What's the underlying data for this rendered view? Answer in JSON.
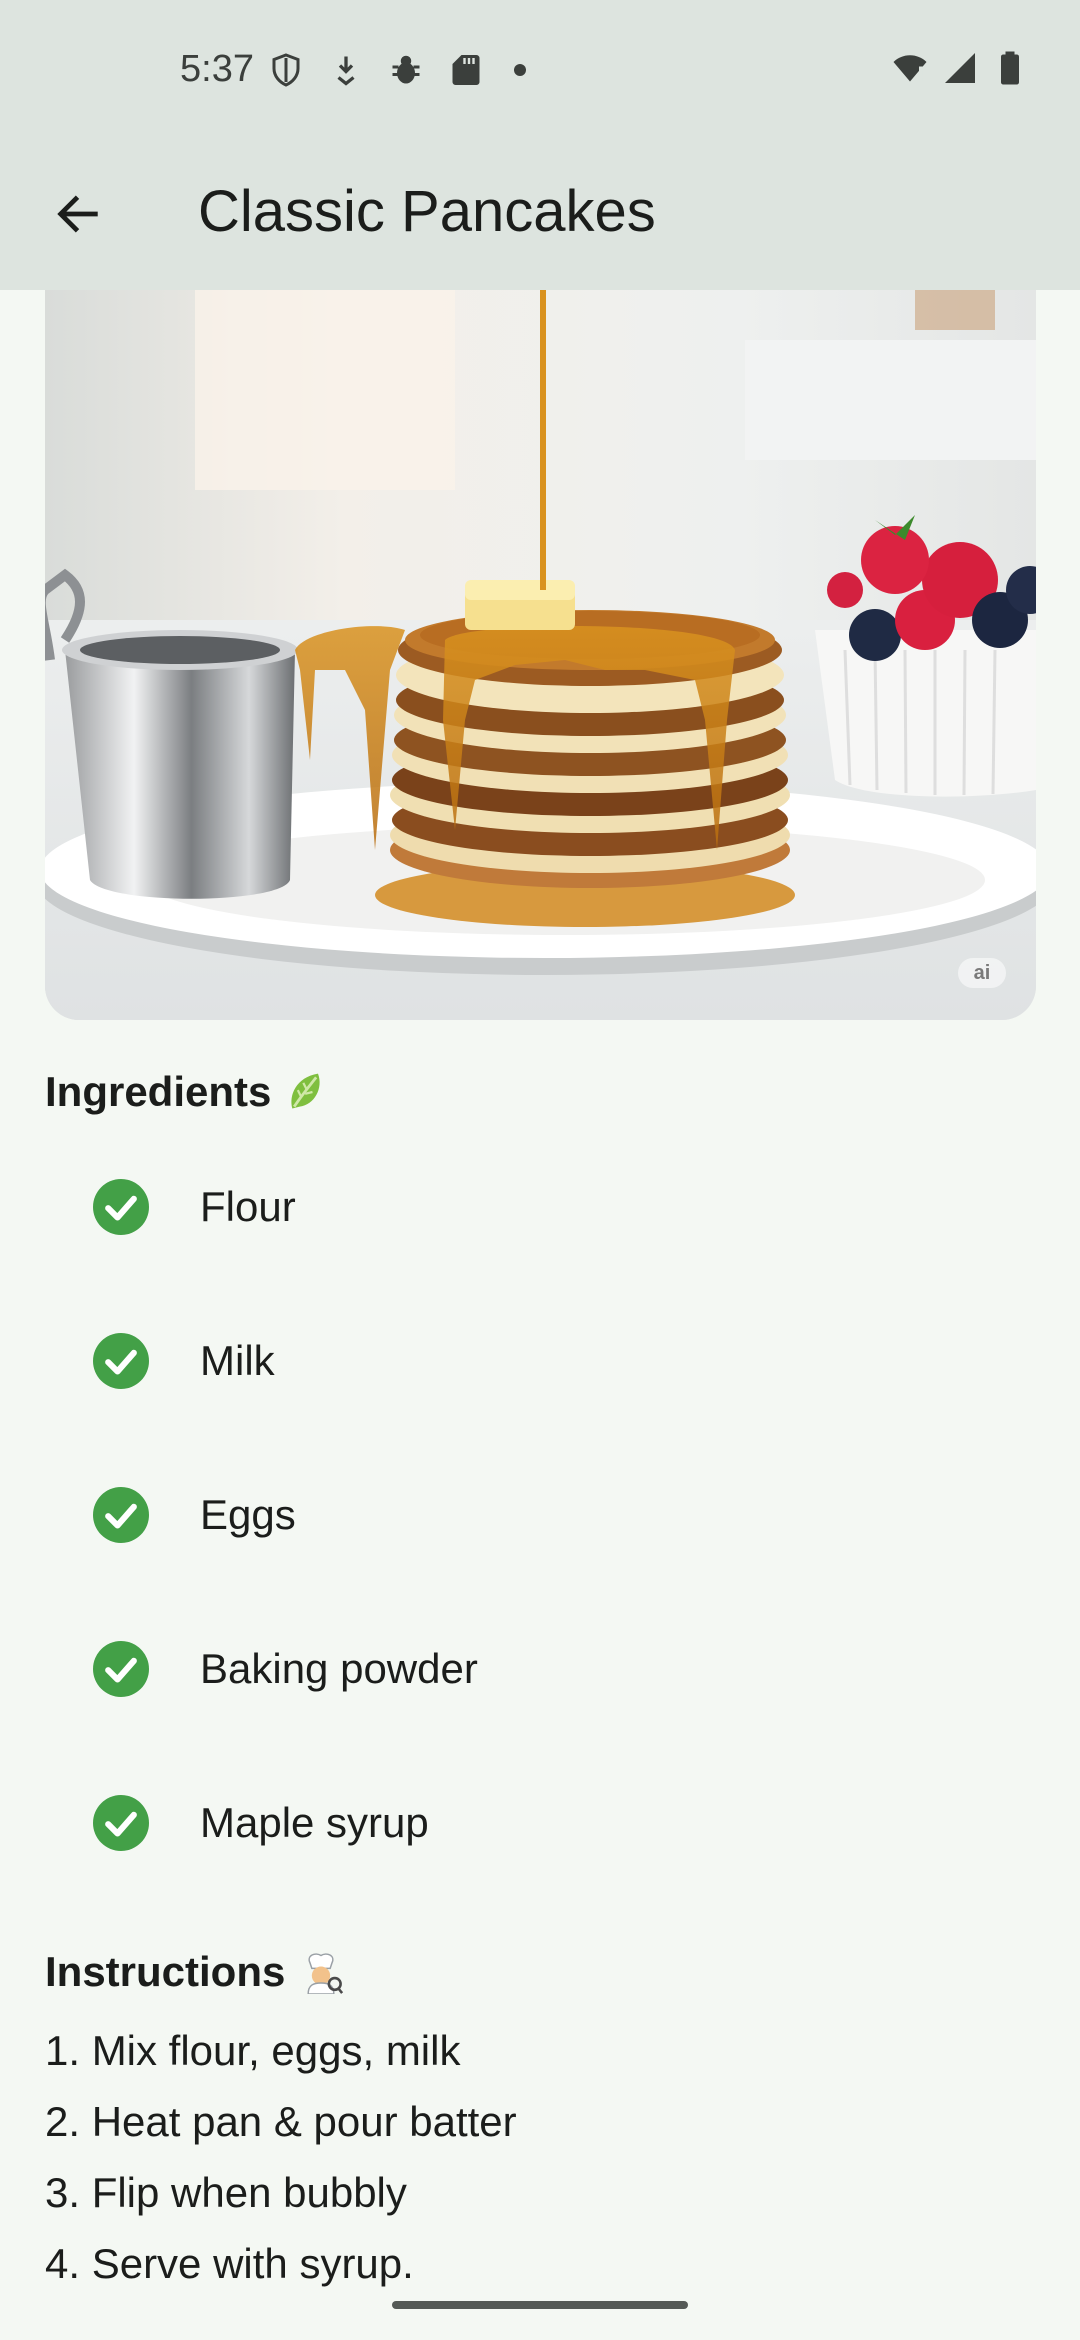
{
  "status_bar": {
    "time": "5:37",
    "left_icons": [
      "shield-icon",
      "download-icon",
      "bug-icon",
      "sd-card-icon",
      "dot-icon"
    ],
    "right_icons": [
      "wifi-alert-icon",
      "cell-signal-icon",
      "battery-icon"
    ]
  },
  "app_bar": {
    "back_icon": "arrow-back-icon",
    "title": "Classic Pancakes"
  },
  "hero": {
    "image": "stack of pancakes with maple syrup, butter, berries and a syrup pitcher",
    "badge": "ai"
  },
  "ingredients": {
    "heading": "Ingredients",
    "heading_icon": "leafy-green-icon",
    "items": [
      {
        "label": "Flour",
        "checked": true
      },
      {
        "label": "Milk",
        "checked": true
      },
      {
        "label": "Eggs",
        "checked": true
      },
      {
        "label": "Baking powder",
        "checked": true
      },
      {
        "label": "Maple syrup",
        "checked": true
      }
    ]
  },
  "instructions": {
    "heading": "Instructions",
    "heading_icon": "cook-icon",
    "steps": [
      "1. Mix flour, eggs, milk",
      "2. Heat pan & pour batter",
      "3. Flip when bubbly",
      "4. Serve with syrup."
    ]
  },
  "colors": {
    "app_bar": "#dde4df",
    "background": "#f4f8f3",
    "check": "#43a047"
  }
}
